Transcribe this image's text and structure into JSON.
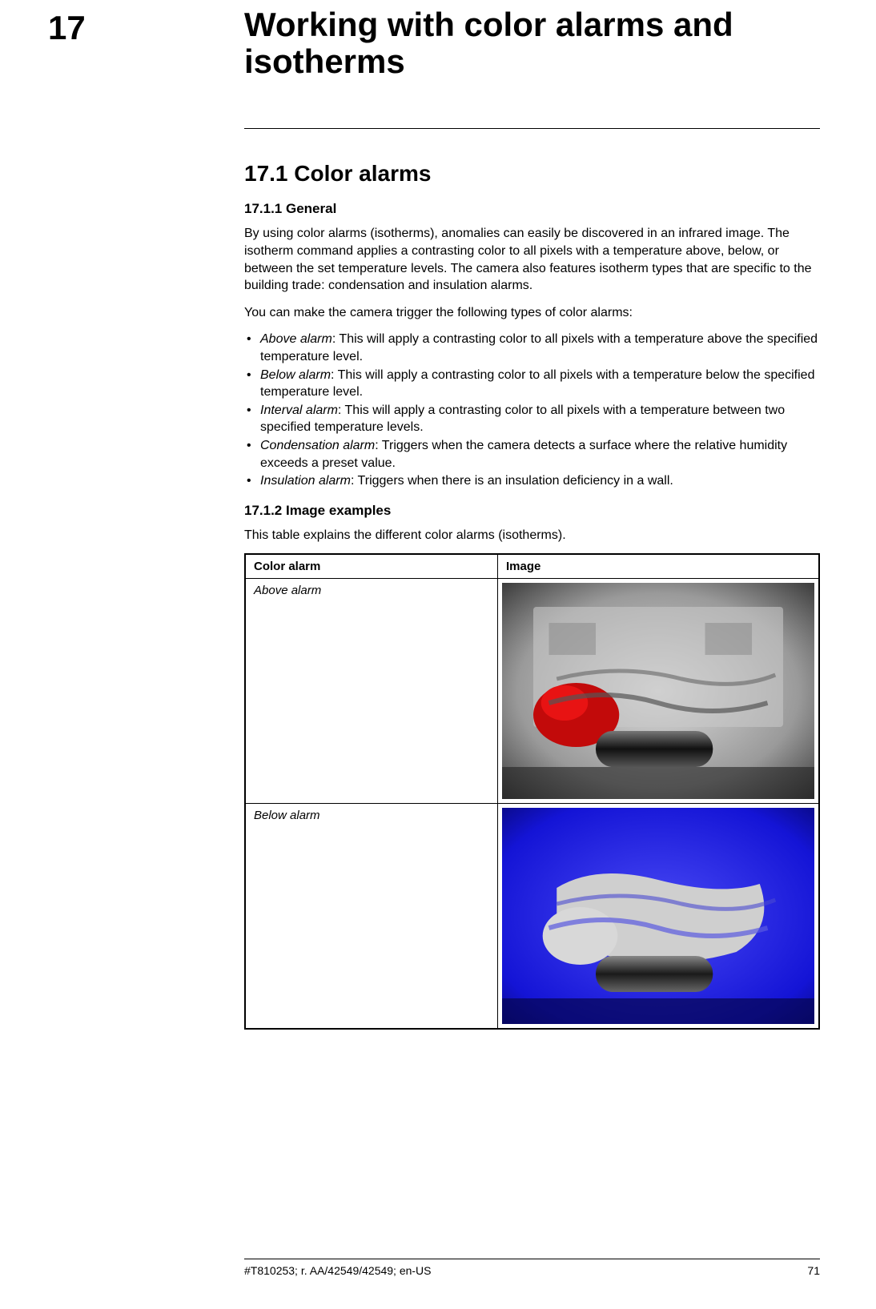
{
  "chapter": {
    "number": "17",
    "title": "Working with color alarms and isotherms"
  },
  "section": {
    "number_title": "17.1    Color alarms"
  },
  "subsection_general": {
    "heading": "17.1.1    General",
    "para1": "By using color alarms (isotherms), anomalies can easily be discovered in an infrared image. The isotherm command applies a contrasting color to all pixels with a temperature above, below, or between the set temperature levels. The camera also features isotherm types that are specific to the building trade: condensation and insulation alarms.",
    "para2": "You can make the camera trigger the following types of color alarms:",
    "alarms": [
      {
        "term": "Above alarm",
        "desc": ": This will apply a contrasting color to all pixels with a temperature above the specified temperature level."
      },
      {
        "term": "Below alarm",
        "desc": ": This will apply a contrasting color to all pixels with a temperature below the specified temperature level."
      },
      {
        "term": "Interval alarm",
        "desc": ": This will apply a contrasting color to all pixels with a temperature between two specified temperature levels."
      },
      {
        "term": "Condensation alarm",
        "desc": ": Triggers when the camera detects a surface where the relative humidity exceeds a preset value."
      },
      {
        "term": "Insulation alarm",
        "desc": ": Triggers when there is an insulation deficiency in a wall."
      }
    ]
  },
  "subsection_examples": {
    "heading": "17.1.2    Image examples",
    "intro": "This table explains the different color alarms (isotherms).",
    "table": {
      "header_col1": "Color alarm",
      "header_col2": "Image",
      "rows": [
        {
          "label": "Above alarm",
          "image_type": "above"
        },
        {
          "label": "Below alarm",
          "image_type": "below"
        }
      ]
    }
  },
  "footer": {
    "docid": "#T810253; r. AA/42549/42549; en-US",
    "page": "71"
  }
}
